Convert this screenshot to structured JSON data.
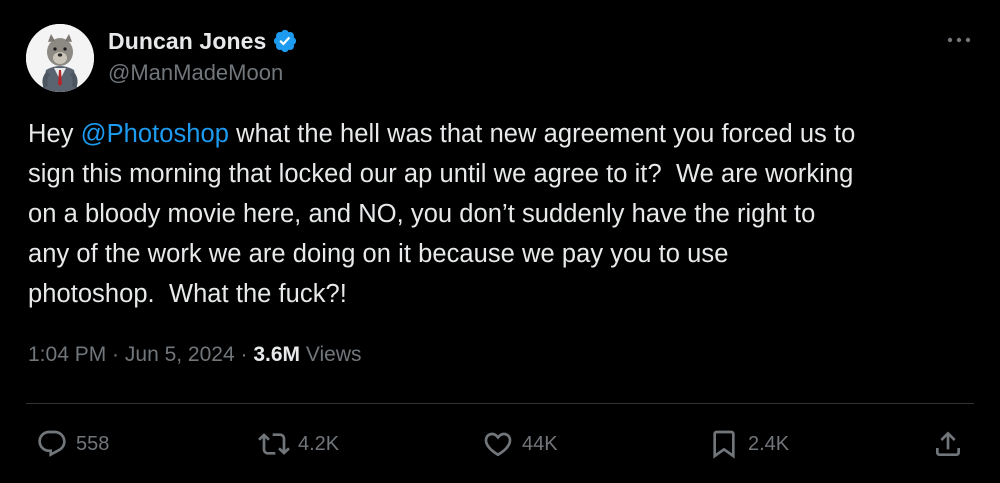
{
  "author": {
    "display_name": "Duncan Jones",
    "handle": "@ManMadeMoon",
    "verified": true,
    "verified_color": "#1d9bf0"
  },
  "tweet": {
    "lines": [
      [
        "Hey ",
        "@Photoshop",
        " what the hell was that new agreement you forced us to"
      ],
      [
        "sign this morning that locked our ap until we agree to it?  We are working"
      ],
      [
        "on a bloody movie here, and NO, you don’t suddenly have the right to"
      ],
      [
        "any of the work we are doing on it because we pay you to use"
      ],
      [
        "photoshop.  What the fuck?!"
      ]
    ],
    "mention": "@Photoshop",
    "mention_color": "#1d9bf0"
  },
  "meta": {
    "time": "1:04 PM",
    "separator": " · ",
    "date": "Jun 5, 2024",
    "views_count": "3.6M",
    "views_label": " Views"
  },
  "actions": {
    "replies": "558",
    "reposts": "4.2K",
    "likes": "44K",
    "bookmarks": "2.4K"
  },
  "icons": {
    "more": "more-horizontal-icon",
    "reply": "reply-icon",
    "repost": "repost-icon",
    "like": "heart-icon",
    "bookmark": "bookmark-icon",
    "share": "share-icon"
  },
  "colors": {
    "background": "#000000",
    "text": "#e7e9ea",
    "secondary": "#71767b",
    "accent": "#1d9bf0",
    "divider": "#2f3336"
  }
}
